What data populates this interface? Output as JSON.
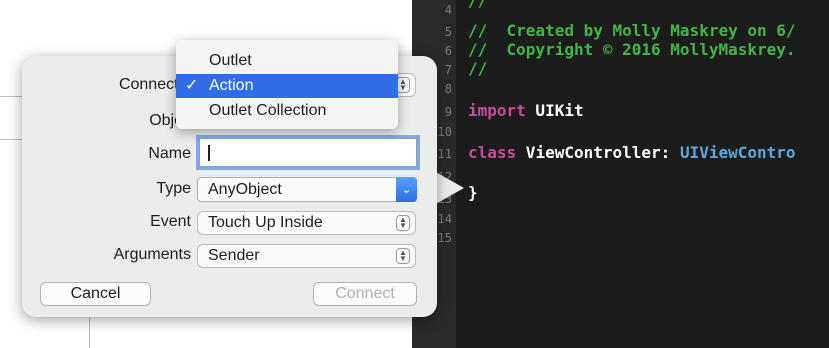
{
  "editor": {
    "line_numbers": [
      "4",
      "5",
      "6",
      "7",
      "8",
      "9",
      "10",
      "11",
      "12",
      "13",
      "14",
      "15"
    ],
    "lines": {
      "comment_top": "//",
      "created": "//  Created by Molly Maskrey on 6/",
      "copyright": "//  Copyright © 2016 MollyMaskrey.",
      "comment_end": "//",
      "import_kw": "import",
      "import_mod": " UIKit",
      "class_kw": "class",
      "class_name": " ViewController: ",
      "superclass": "UIViewContro",
      "brace": "}"
    }
  },
  "dialog": {
    "labels": {
      "connection": "Connectio",
      "object": "Objec",
      "name": "Name",
      "type": "Type",
      "event": "Event",
      "arguments": "Arguments"
    },
    "name_value": "",
    "type_value": "AnyObject",
    "event_value": "Touch Up Inside",
    "arguments_value": "Sender",
    "cancel_label": "Cancel",
    "connect_label": "Connect"
  },
  "connection_menu": {
    "items": [
      "Outlet",
      "Action",
      "Outlet Collection"
    ],
    "selected": "Action",
    "check": "✓"
  },
  "colors": {
    "selection": "#2f6ee6",
    "comment": "#41b645",
    "keyword": "#c94b9b",
    "type": "#5ea8d9"
  }
}
